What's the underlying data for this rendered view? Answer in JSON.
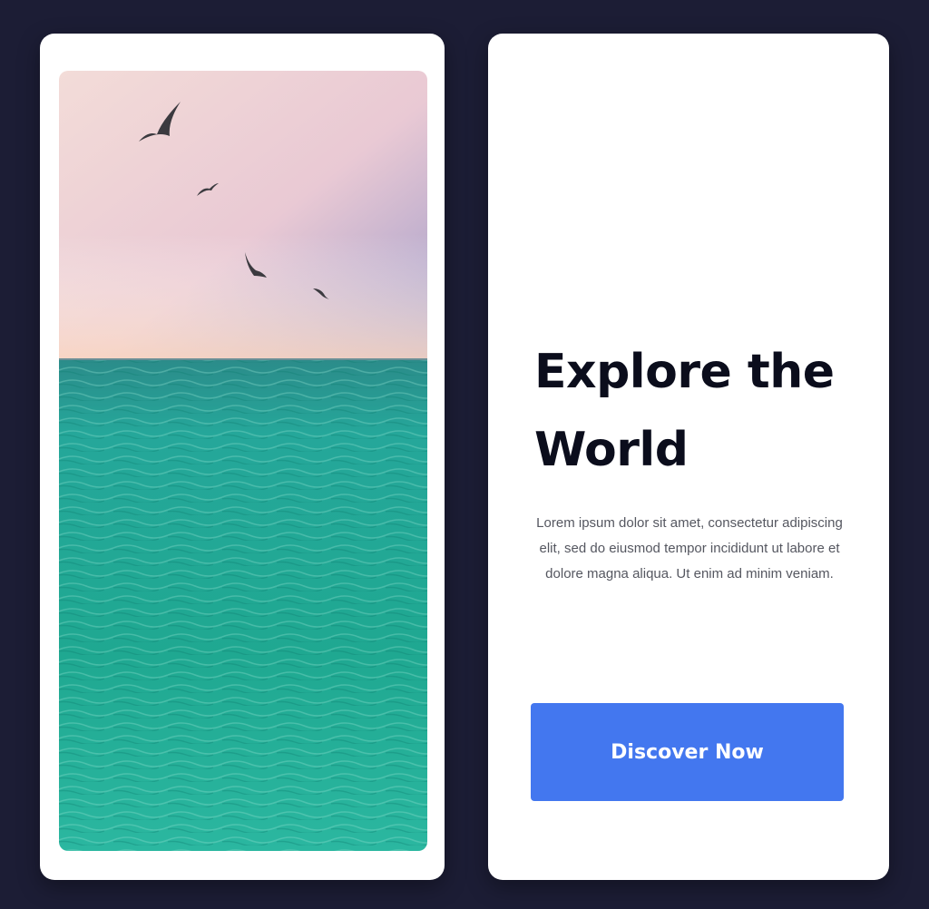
{
  "hero": {
    "title": "Explore the World",
    "description": "Lorem ipsum dolor sit amet, consectetur adipiscing elit, sed do eiusmod tempor incididunt ut labore et dolore magna aliqua. Ut enim ad minim veniam.",
    "cta_label": "Discover Now"
  },
  "colors": {
    "background": "#1c1d35",
    "card": "#ffffff",
    "accent": "#4377ef",
    "heading": "#0b0d1c",
    "sea": "#1fa896",
    "sky_top": "#a99ec8",
    "sky_horizon": "#f2d2c4"
  },
  "image": {
    "subject": "ocean-with-seagulls"
  }
}
